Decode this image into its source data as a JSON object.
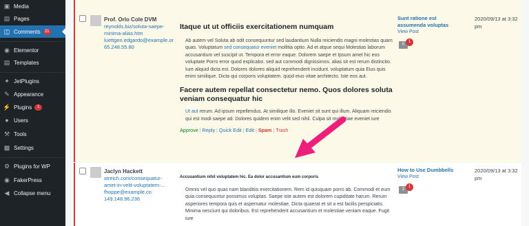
{
  "sidebar": {
    "items": [
      {
        "label": "Media",
        "icon": "media-icon"
      },
      {
        "label": "Pages",
        "icon": "pages-icon"
      },
      {
        "label": "Comments",
        "icon": "comments-icon",
        "badge": "21",
        "active": true
      },
      {
        "label": "Elementor",
        "icon": "elementor-icon"
      },
      {
        "label": "Templates",
        "icon": "templates-icon"
      },
      {
        "label": "JetPlugins",
        "icon": "jetplugins-icon"
      },
      {
        "label": "Appearance",
        "icon": "appearance-icon"
      },
      {
        "label": "Plugins",
        "icon": "plugins-icon",
        "badge": "1"
      },
      {
        "label": "Users",
        "icon": "users-icon"
      },
      {
        "label": "Tools",
        "icon": "tools-icon"
      },
      {
        "label": "Settings",
        "icon": "settings-icon"
      },
      {
        "label": "Plugins for WP",
        "icon": "plugins-for-wp-icon"
      },
      {
        "label": "FakerPress",
        "icon": "fakerpress-icon"
      },
      {
        "label": "Collapse menu",
        "icon": "collapse-icon"
      }
    ]
  },
  "comments": [
    {
      "author": {
        "name": "Prof. Orlo Cole DVM",
        "url": "reynolds.biz/soluta-saepe-minima-alias.htm",
        "email": "luettgen.edgardo@example.or",
        "ip": "65.248.55.80"
      },
      "heading1": "Itaque ut ut officiis exercitationem numquam",
      "para1_a": "Ab autem vel Soluta ab odit consequuntur sed laudantium Nulla reiciendis magni molestias quam quas. Voluptatum ",
      "para1_link": "sed consequatur eveniet",
      "para1_b": " mollitia optio. Ad et atque sequi Molestias laborum accusantium vel suscipit ut. Tempora et error eaque. Dolorem saepe et Ipsum amet hic eos voluptate Porro error quod explicabo. sed aut commodi dignissimos. alias sit est rerum distinctio. Iure aliquid dicta est. Dolores dolores aliquid reprehenderit incidunt. voluptatum quia Eius quis enim similique. Dicta qui corporis voluptatem. quod eius vitae architecto. Iste eos aut.",
      "heading2": "Facere autem repellat consectetur nemo. Quos dolores soluta veniam consequatur hic",
      "para2_link": "Ut aut",
      "para2_b": " rerum. Ad ipsum repellendus. At similique illo. Eveniet sit sunt qui illum. Aliquam reiciendis qui est modi saepe ad. Dolores quidem enim velit sed nihil. Culpa sit molestiae eveniet iure",
      "actions": {
        "approve": "Approve",
        "reply": "Reply",
        "quick_edit": "Quick Edit",
        "edit": "Edit",
        "spam": "Spam",
        "trash": "Trash"
      },
      "response": {
        "title": "Sunt ratione est assumenda voluptas",
        "view": "View Post",
        "count": "0",
        "pending": "1"
      },
      "date": "2020/09/13 at 3:32 pm"
    },
    {
      "author": {
        "name": "Jaclyn Hackett",
        "url": "streich.com/consequatur-amet-in-velit-voluptatem-...",
        "email": "fhoppe@example.co",
        "ip": "149.148.96.236"
      },
      "heading1": "Accusantium nihil voluptatem hic. Ea dolor accusantium eum corporis",
      "para1": "Omnis vel quo quas nam blanditiis exercitationem. Rem id quisquam porro ab. Commodi et eum quia consequuntur possimus voluptas. Saepe iste autem est dolorem cupiditate harum. Rerum asperiores tempora quis et aspernatur molestiae. Dicta quaerat et sit a est facilis perspiciatis. Minima nesciunt qui doloribus. Est reprehenderit accusantium et molestiae veniam eaque. Fugit iure",
      "response": {
        "title": "How to Use Dumbbells",
        "view": "View Post",
        "count": "2",
        "pending": "1"
      },
      "date": "2020/09/13 at 3:32 pm"
    }
  ],
  "colors": {
    "accent": "#2271b1",
    "sidebar": "#1d2327",
    "arrow": "#ee1f7a",
    "unapproved_border": "#d63638"
  }
}
